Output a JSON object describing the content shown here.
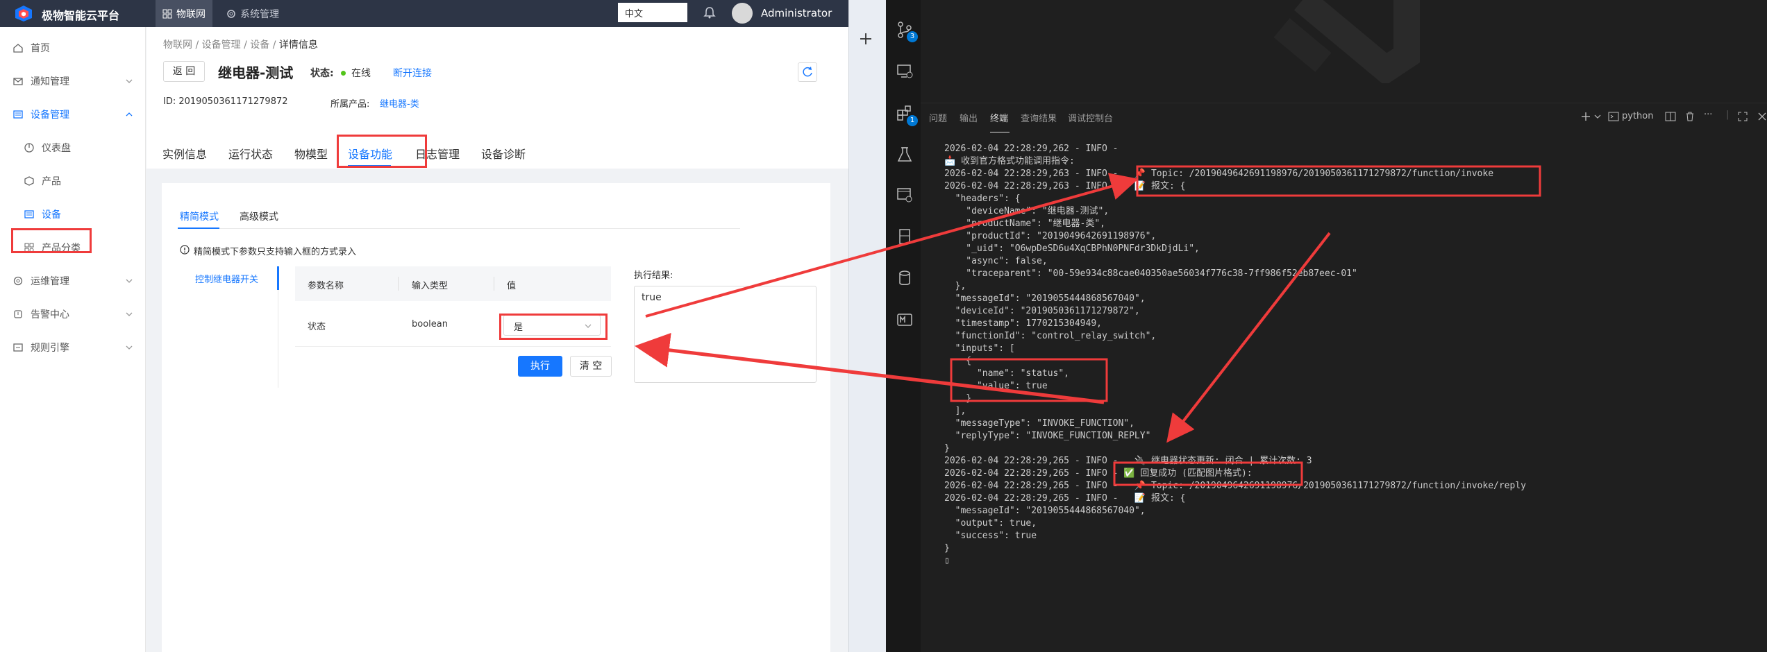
{
  "app": {
    "brand": "极物智能云平台",
    "nav_iot": "物联网",
    "nav_system": "系统管理",
    "language": "中文",
    "username": "Administrator"
  },
  "sidebar": {
    "items": [
      {
        "label": "首页"
      },
      {
        "label": "通知管理"
      },
      {
        "label": "设备管理"
      },
      {
        "label": "仪表盘"
      },
      {
        "label": "产品"
      },
      {
        "label": "设备"
      },
      {
        "label": "产品分类"
      },
      {
        "label": "运维管理"
      },
      {
        "label": "告警中心"
      },
      {
        "label": "规则引擎"
      }
    ]
  },
  "breadcrumb": [
    "物联网",
    "设备管理",
    "设备",
    "详情信息"
  ],
  "device": {
    "back_label": "返 回",
    "title": "继电器-测试",
    "status_label": "状态:",
    "status_value": "在线",
    "disconnect": "断开连接",
    "id_text": "ID: 2019050361171279872",
    "product_label": "所属产品:",
    "product_value": "继电器-类"
  },
  "tabs": [
    "实例信息",
    "运行状态",
    "物模型",
    "设备功能",
    "日志管理",
    "设备诊断"
  ],
  "function_panel": {
    "subtabs": [
      "精简模式",
      "高级模式"
    ],
    "tip": "精简模式下参数只支持输入框的方式录入",
    "function_item": "控制继电器开关",
    "columns": [
      "参数名称",
      "输入类型",
      "值"
    ],
    "row": {
      "name": "状态",
      "type": "boolean",
      "value": "是"
    },
    "execute": "执行",
    "clear": "清 空",
    "result_label": "执行结果:",
    "result_value": "true"
  },
  "ide": {
    "badges": [
      "3",
      "1"
    ],
    "panel_tabs": [
      "问题",
      "输出",
      "终端",
      "查询结果",
      "调试控制台"
    ],
    "shell": "python",
    "terminal_lines": [
      "2026-02-04 22:28:29,262 - INFO -",
      "📩 收到官方格式功能调用指令:",
      "2026-02-04 22:28:29,263 - INFO -   📌 Topic: /2019049642691198976/2019050361171279872/function/invoke",
      "2026-02-04 22:28:29,263 - INFO -   📝 报文: {",
      "  \"headers\": {",
      "    \"deviceName\": \"继电器-测试\",",
      "    \"productName\": \"继电器-类\",",
      "    \"productId\": \"2019049642691198976\",",
      "    \"_uid\": \"O6wpDeSD6u4XqCBPhN0PNFdr3DkDjdLi\",",
      "    \"async\": false,",
      "    \"traceparent\": \"00-59e934c88cae040350ae56034f776c38-7ff986f52eb87eec-01\"",
      "  },",
      "  \"messageId\": \"2019055444868567040\",",
      "  \"deviceId\": \"2019050361171279872\",",
      "  \"timestamp\": 1770215304949,",
      "  \"functionId\": \"control_relay_switch\",",
      "  \"inputs\": [",
      "    {",
      "      \"name\": \"status\",",
      "      \"value\": true",
      "    }",
      "  ],",
      "  \"messageType\": \"INVOKE_FUNCTION\",",
      "  \"replyType\": \"INVOKE_FUNCTION_REPLY\"",
      "}",
      "2026-02-04 22:28:29,265 - INFO -   🔌 继电器状态更新: 闭合 | 累计次数: 3",
      "2026-02-04 22:28:29,265 - INFO - ✅ 回复成功 (匹配图片格式):",
      "2026-02-04 22:28:29,265 - INFO -   📌 Topic: /2019049642691198976/2019050361171279872/function/invoke/reply",
      "2026-02-04 22:28:29,265 - INFO -   📝 报文: {",
      "  \"messageId\": \"2019055444868567040\",",
      "  \"output\": true,",
      "  \"success\": true",
      "}",
      "▯"
    ]
  },
  "colors": {
    "primary": "#1677ff",
    "annotation": "#ef3b3b",
    "topbar": "#2d3546",
    "terminal_bg": "#1f1f1f"
  }
}
